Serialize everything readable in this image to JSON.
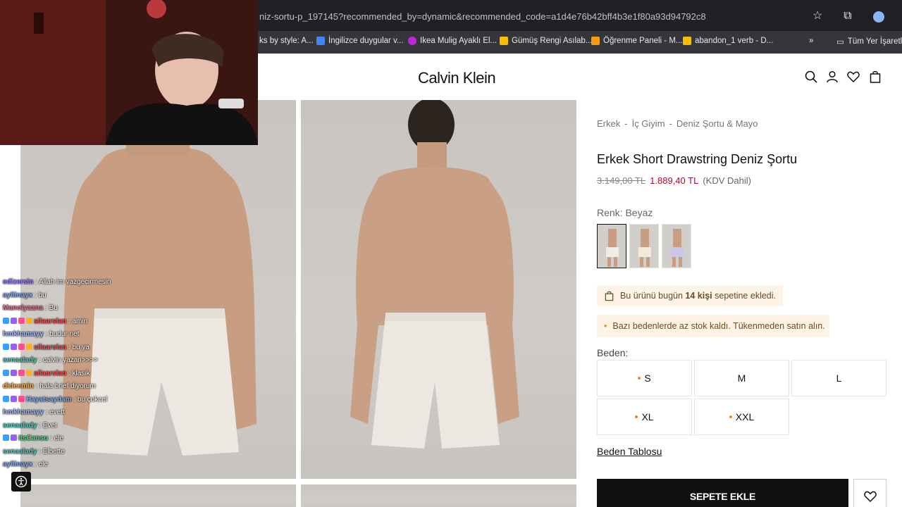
{
  "browser": {
    "url": "niz-sortu-p_197145?recommended_by=dynamic&recommended_code=a1d4e76b42bff4b3e1f80a93d94792c8",
    "bookmarks": [
      {
        "label": "ks by style: A...",
        "color": "#8ab4f8"
      },
      {
        "label": "İngilizce duygular v...",
        "color": "#4285f4"
      },
      {
        "label": "Ikea Mulig Ayaklı El...",
        "color": "#c026d3"
      },
      {
        "label": "Gümüş Rengi Asılab...",
        "color": "#fbbc04"
      },
      {
        "label": "Öğrenme Paneli - M...",
        "color": "#f59e0b"
      },
      {
        "label": "abandon_1 verb - D...",
        "color": "#fbbc04"
      }
    ],
    "more_glyph": "»",
    "all_bookmarks": "Tüm Yer İşaretleri"
  },
  "site": {
    "logo": "Calvin Klein",
    "icons": [
      "search-icon",
      "account-icon",
      "wishlist-icon",
      "cart-icon"
    ]
  },
  "product": {
    "breadcrumb": [
      "Erkek",
      "İç Giyim",
      "Deniz Şortu & Mayo"
    ],
    "breadcrumb_sep": "-",
    "title": "Erkek Short Drawstring Deniz Şortu",
    "old_price": "3.149,00 TL",
    "price": "1.889,40 TL",
    "vat": "(KDV Dahil)",
    "color_label": "Renk: Beyaz",
    "swatch_colors": [
      "#e9e6e2",
      "#efe9df",
      "#c9c6e8"
    ],
    "notice_cart_prefix": "Bu ürünü bugün ",
    "notice_cart_bold": "14 kişi",
    "notice_cart_suffix": " sepetine ekledi.",
    "notice_stock": "Bazı bedenlerde az stok kaldı. Tükenmeden satın alın.",
    "size_label": "Beden:",
    "sizes": [
      {
        "label": "S",
        "low_stock": true
      },
      {
        "label": "M",
        "low_stock": false
      },
      {
        "label": "L",
        "low_stock": false
      },
      {
        "label": "XL",
        "low_stock": true
      },
      {
        "label": "XXL",
        "low_stock": true
      }
    ],
    "size_chart": "Beden Tablosu",
    "add_to_cart": "SEPETE EKLE"
  },
  "chat": [
    {
      "user": "edizersin",
      "msg": "Allah im vazgecirmesin",
      "color": "#9b7bff",
      "badges": 0
    },
    {
      "user": "ayliinayx",
      "msg": "bu",
      "color": "#7aa7ff",
      "badges": 0
    },
    {
      "user": "Manolyaana",
      "msg": "Bu",
      "color": "#ff6b8a",
      "badges": 0
    },
    {
      "user": "silaarslan",
      "msg": "amin",
      "color": "#ff4d4d",
      "badges": 4
    },
    {
      "user": "hmkhamayy",
      "msg": "budur net",
      "color": "#9fb8ff",
      "badges": 0
    },
    {
      "user": "silaarslan",
      "msg": "bu ya",
      "color": "#ff4d4d",
      "badges": 4
    },
    {
      "user": "senaalady",
      "msg": "calvin yazan>>>>",
      "color": "#4fd1c5",
      "badges": 0
    },
    {
      "user": "silaarslan",
      "msg": "klasik",
      "color": "#ff4d4d",
      "badges": 4
    },
    {
      "user": "dideemin",
      "msg": "hala brief diyorum",
      "color": "#ffb347",
      "badges": 0
    },
    {
      "user": "Hayatsaydam",
      "msg": "bu çokcel",
      "color": "#7ab8ff",
      "badges": 3
    },
    {
      "user": "hmkhamayy",
      "msg": "evett",
      "color": "#9fb8ff",
      "badges": 0
    },
    {
      "user": "senaalady",
      "msg": "Evet",
      "color": "#4fd1c5",
      "badges": 0
    },
    {
      "user": "itsCansu",
      "msg": "ele",
      "color": "#58d68d",
      "badges": 2
    },
    {
      "user": "senaalady",
      "msg": "Elbette",
      "color": "#4fd1c5",
      "badges": 0
    },
    {
      "user": "ayliinayx",
      "msg": "ele",
      "color": "#7aa7ff",
      "badges": 0
    }
  ]
}
